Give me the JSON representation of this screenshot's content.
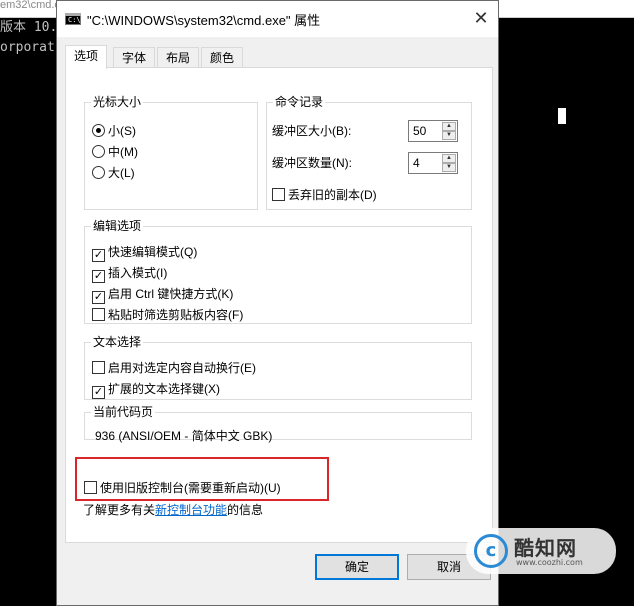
{
  "background_console": {
    "title_fragment": "em32\\cmd.exe",
    "lines": [
      "版本 10.",
      "orporat"
    ]
  },
  "window": {
    "title": "\"C:\\WINDOWS\\system32\\cmd.exe\" 属性",
    "close_glyph": "✕",
    "icon_text": "C:\\"
  },
  "tabs": [
    {
      "label": "选项",
      "active": true
    },
    {
      "label": "字体",
      "active": false
    },
    {
      "label": "布局",
      "active": false
    },
    {
      "label": "颜色",
      "active": false
    }
  ],
  "cursor_size": {
    "title": "光标大小",
    "options": [
      {
        "label": "小(S)",
        "selected": true
      },
      {
        "label": "中(M)",
        "selected": false
      },
      {
        "label": "大(L)",
        "selected": false
      }
    ]
  },
  "command_history": {
    "title": "命令记录",
    "buffer_size_label": "缓冲区大小(B):",
    "buffer_size_value": "50",
    "buffer_count_label": "缓冲区数量(N):",
    "buffer_count_value": "4",
    "discard_old_label": "丢弃旧的副本(D)",
    "discard_old_checked": false
  },
  "edit_options": {
    "title": "编辑选项",
    "items": [
      {
        "label": "快速编辑模式(Q)",
        "checked": true
      },
      {
        "label": "插入模式(I)",
        "checked": true
      },
      {
        "label": "启用 Ctrl 键快捷方式(K)",
        "checked": true
      },
      {
        "label": "粘贴时筛选剪贴板内容(F)",
        "checked": false
      }
    ]
  },
  "text_selection": {
    "title": "文本选择",
    "items": [
      {
        "label": "启用对选定内容自动换行(E)",
        "checked": false
      },
      {
        "label": "扩展的文本选择键(X)",
        "checked": true
      }
    ]
  },
  "code_page": {
    "title": "当前代码页",
    "value": "936   (ANSI/OEM - 简体中文 GBK)"
  },
  "legacy_console": {
    "label": "使用旧版控制台(需要重新启动)(U)",
    "checked": false
  },
  "info": {
    "prefix": "了解更多有关",
    "link": "新控制台功能",
    "suffix": "的信息"
  },
  "buttons": {
    "ok": "确定",
    "cancel": "取消"
  },
  "watermark": {
    "logo_letter": "c",
    "brand": "酷知网",
    "url": "www.coozhi.com"
  },
  "colors": {
    "highlight_box": "#d8262a",
    "link": "#0066cc",
    "primary_button_border": "#0078d7"
  }
}
